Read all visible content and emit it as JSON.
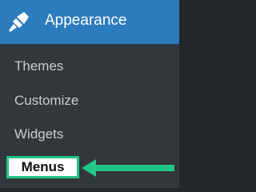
{
  "menu": {
    "title": "Appearance",
    "icon": "paintbrush-icon",
    "items": [
      {
        "label": "Themes"
      },
      {
        "label": "Customize"
      },
      {
        "label": "Widgets"
      },
      {
        "label": "Menus",
        "highlighted": true
      }
    ]
  },
  "colors": {
    "header_bg": "#2b7bbd",
    "submenu_bg": "#32373c",
    "highlight_border": "#23c586",
    "arrow": "#23c586"
  },
  "annotation": {
    "arrow_icon": "arrow-left-icon"
  }
}
